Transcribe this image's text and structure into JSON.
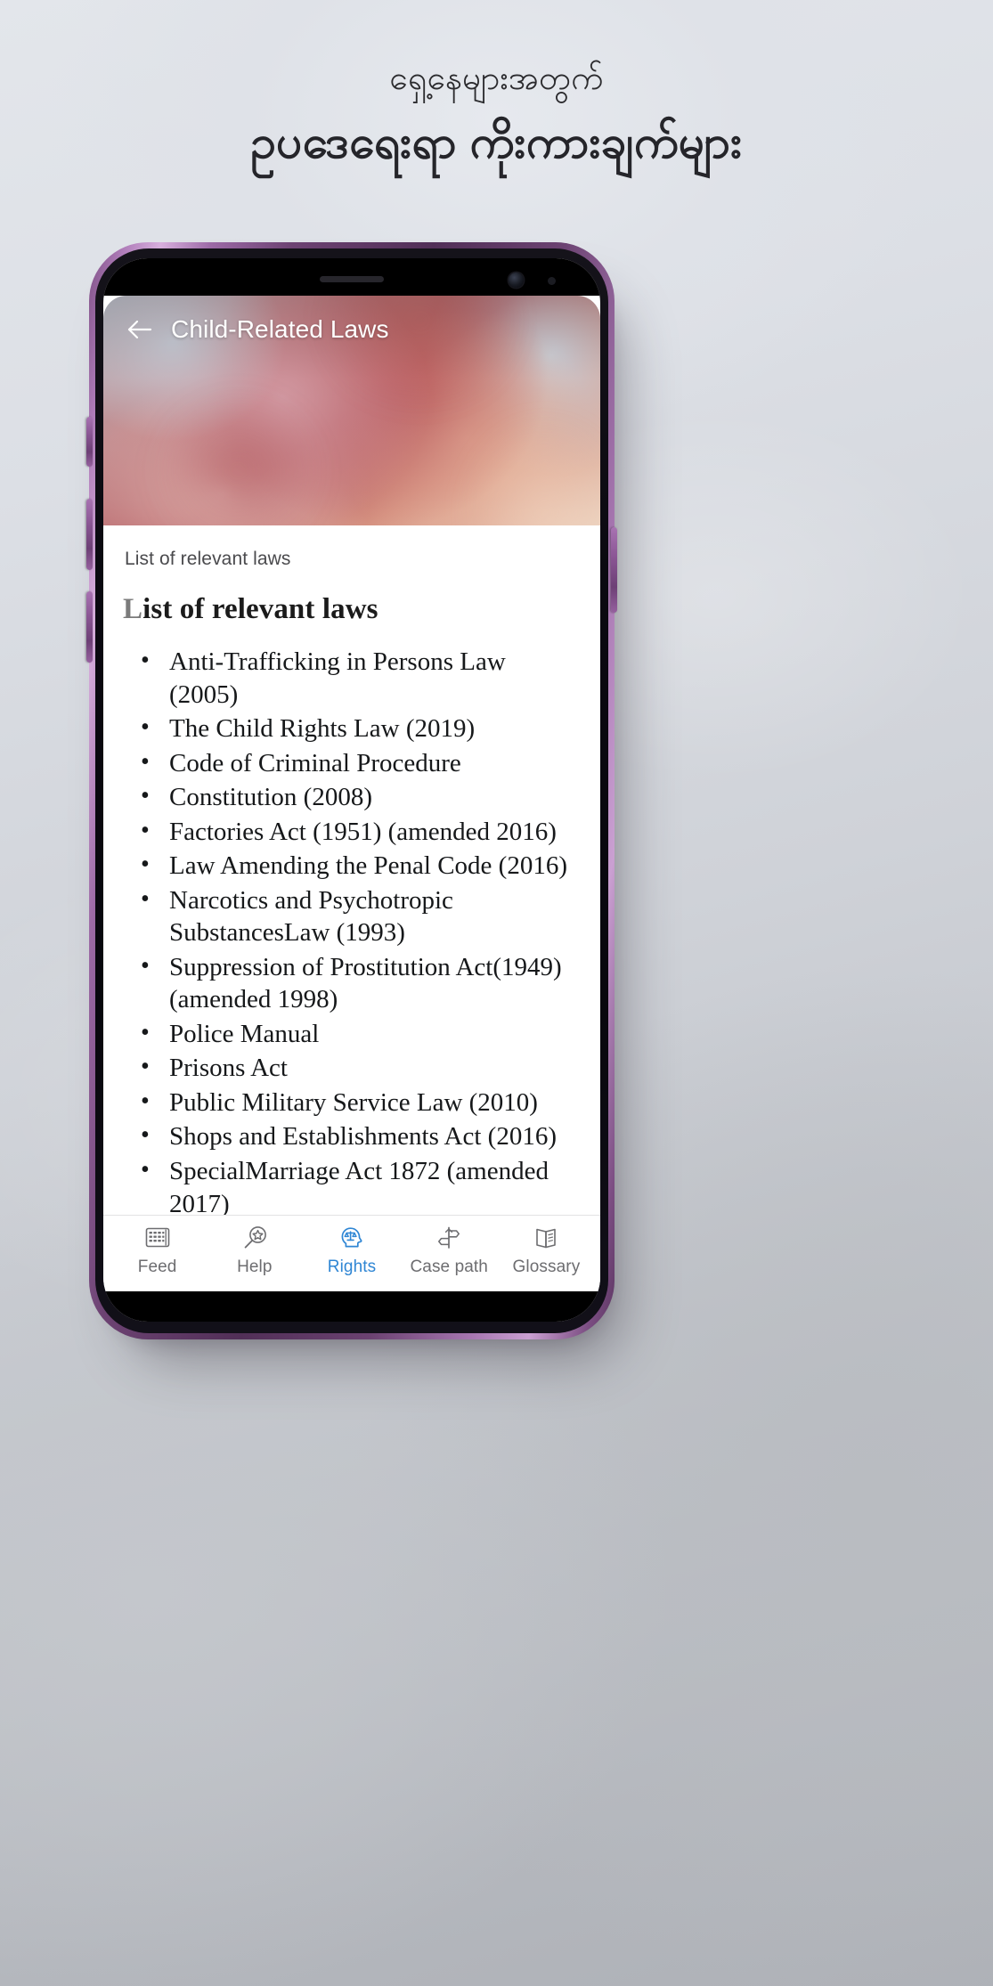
{
  "poster": {
    "headline_sub": "ရှေ့နေများအတွက်",
    "headline_main": "ဥပဒေရေးရာ ကိုးကားချက်များ"
  },
  "phone": {
    "frame_color": "#8a56a0",
    "accent_color": "#2f86d4"
  },
  "app": {
    "appbar": {
      "back_icon": "arrow-left-icon",
      "title": "Child-Related Laws"
    },
    "content": {
      "breadcrumb": "List of relevant laws",
      "doc_title": "List of relevant laws",
      "laws": [
        "Anti-Trafficking in Persons Law (2005)",
        "The Child Rights Law (2019)",
        "Code of Criminal Procedure",
        "Constitution (2008)",
        "Factories Act (1951) (amended 2016)",
        "Law Amending the Penal Code (2016)",
        "Narcotics and Psychotropic SubstancesLaw (1993)",
        "Suppression of Prostitution Act(1949) (amended 1998)",
        "Police Manual",
        "Prisons Act",
        "Public Military Service Law (2010)",
        "Shops and Establishments Act (2016)",
        "SpecialMarriage Act 1872 (amended 2017)"
      ]
    },
    "bottom_nav": [
      {
        "label": "Feed",
        "icon": "feed-grid-icon",
        "active": false
      },
      {
        "label": "Help",
        "icon": "magnifier-star-icon",
        "active": false
      },
      {
        "label": "Rights",
        "icon": "head-scales-icon",
        "active": true
      },
      {
        "label": "Case path",
        "icon": "signpost-icon",
        "active": false
      },
      {
        "label": "Glossary",
        "icon": "open-book-icon",
        "active": false
      }
    ]
  }
}
